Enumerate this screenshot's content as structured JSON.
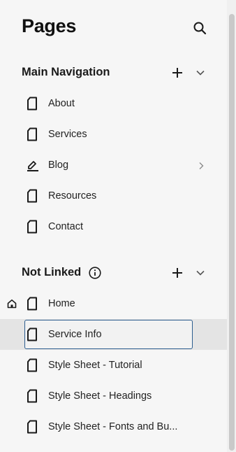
{
  "header": {
    "title": "Pages",
    "search_icon": "search-icon"
  },
  "sections": {
    "main_navigation": {
      "title": "Main Navigation",
      "items": [
        {
          "label": "About",
          "icon": "page-icon"
        },
        {
          "label": "Services",
          "icon": "page-icon"
        },
        {
          "label": "Blog",
          "icon": "blog-icon",
          "has_children": true
        },
        {
          "label": "Resources",
          "icon": "page-icon"
        },
        {
          "label": "Contact",
          "icon": "page-icon"
        }
      ]
    },
    "not_linked": {
      "title": "Not Linked",
      "items": [
        {
          "label": "Home",
          "icon": "page-icon",
          "is_homepage": true
        },
        {
          "label": "Service Info",
          "icon": "page-icon",
          "selected": true
        },
        {
          "label": "Style Sheet - Tutorial",
          "icon": "page-icon"
        },
        {
          "label": "Style Sheet - Headings",
          "icon": "page-icon"
        },
        {
          "label": "Style Sheet - Fonts and Bu...",
          "icon": "page-icon"
        }
      ]
    }
  },
  "colors": {
    "background": "#f6f6f6",
    "selected_row": "#e4e4e4",
    "focus_border": "#2c5d8f",
    "text": "#1c1c1c"
  }
}
